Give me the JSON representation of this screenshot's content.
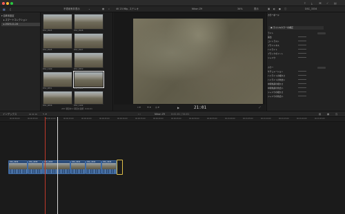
{
  "window": {
    "traffic_lights": [
      "#ff5f57",
      "#febc2e",
      "#28c840"
    ]
  },
  "toolbar": {
    "browser_filter": "不適用有非表示",
    "viewer_format": "4K 23.98p, ステレオ",
    "project_name": "Nikon Z9",
    "zoom": "34%",
    "view_menu": "表示",
    "inspector_clip": "DSC_3334"
  },
  "libraries": {
    "items": [
      {
        "label": "名称未設定",
        "selected": false
      },
      {
        "label": "スマートコレクション",
        "selected": false
      },
      {
        "label": "2025-11-24",
        "selected": true
      }
    ]
  },
  "browser": {
    "clips": [
      {
        "name": "DSC_0945"
      },
      {
        "name": "DSC_0948"
      },
      {
        "name": "DSC_0945"
      },
      {
        "name": "DSC_0947"
      },
      {
        "name": "DSC_1100"
      },
      {
        "name": "DSC_0950"
      },
      {
        "name": "DSC_0051"
      },
      {
        "name": "DSC_1101"
      },
      {
        "name": "DSC_0056"
      },
      {
        "name": "DSC_1102"
      }
    ],
    "status": "257 項目中 1 項目を選択, 9:41:01"
  },
  "viewer": {
    "timecode": "21:01"
  },
  "inspector": {
    "title": "カラーボード",
    "header": "ライト&カラーの補正",
    "rows": [
      "ライト",
      "露出",
      "コントラスト",
      "ブライトネス",
      "ハイライト",
      "ブラックポイント",
      "シャドウ",
      "カラー",
      "サチュレーション",
      "ハイライトの暖かさ",
      "ハイライトの色合い",
      "中間色調の暖かさ",
      "中間色調の色合い",
      "シャドウの暖かさ",
      "シャドウの色合い"
    ]
  },
  "timeline": {
    "index_label": "インデックス",
    "project_label": "Nikon Z9",
    "duration": "0:41:01 / 54:01",
    "ruler_ticks": [
      "00:00:00:00",
      "00:00:05:00",
      "00:00:10:00",
      "00:00:15:00",
      "00:00:20:00",
      "00:00:25:00",
      "00:00:30:00",
      "00:00:35:00",
      "00:00:40:00",
      "00:00:45:00",
      "00:00:50:00",
      "00:00:55:00",
      "00:01:00:00",
      "00:01:05:00",
      "00:01:10:00",
      "00:01:15:00",
      "00:01:20:00",
      "00:01:25:00"
    ],
    "clips": [
      {
        "name": "DSC_0936"
      },
      {
        "name": "DSC_0938"
      },
      {
        "name": "DSC_0940"
      },
      {
        "name": "DSC_0942"
      },
      {
        "name": "DSC_0944"
      },
      {
        "name": "DSC_0946"
      }
    ]
  }
}
